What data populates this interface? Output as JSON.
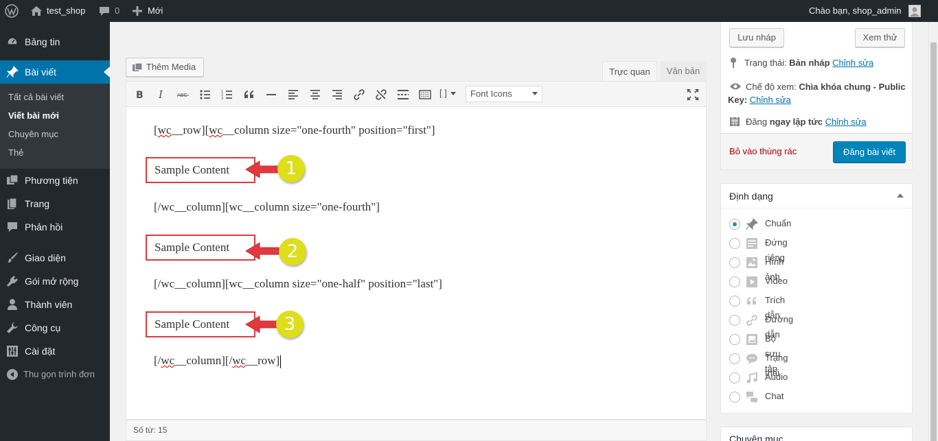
{
  "adminbar": {
    "site_name": "test_shop",
    "comments_count": "0",
    "new_label": "Mới",
    "greeting": "Chào bạn, shop_admin"
  },
  "sidebar": {
    "dashboard": "Bảng tin",
    "posts": "Bài viết",
    "posts_sub": [
      "Tất cả bài viết",
      "Viết bài mới",
      "Chuyên mục",
      "Thẻ"
    ],
    "media": "Phương tiện",
    "pages": "Trang",
    "comments": "Phản hồi",
    "appearance": "Giao diện",
    "plugins": "Gói mở rộng",
    "users": "Thành viên",
    "tools": "Công cụ",
    "settings": "Cài đặt",
    "collapse": "Thu gọn trình đơn"
  },
  "editor": {
    "add_media": "Thêm Media",
    "tab_visual": "Trực quan",
    "tab_text": "Văn bản",
    "font_icons": "Font Icons",
    "shortcode_label": "[ ]",
    "lines": {
      "l1_a": "[",
      "l1_b": "wc",
      "l1_c": "__row][",
      "l1_d": "wc",
      "l1_e": "__column size=\"one-fourth\" position=\"first\"]",
      "l2": "[/wc__column][wc__column size=\"one-fourth\"]",
      "l3": "[/wc__column][wc__column size=\"one-half\" position=\"last\"]",
      "l4_a": "[/",
      "l4_b": "wc",
      "l4_c": "__column][/",
      "l4_d": "wc",
      "l4_e": "__row]"
    },
    "samples": [
      "Sample Content",
      "Sample Content",
      "Sample Content"
    ],
    "badges": [
      "1",
      "2",
      "3"
    ],
    "word_count": "Số từ: 15"
  },
  "publish": {
    "save_draft": "Lưu nháp",
    "preview": "Xem thử",
    "status_label": "Trạng thái: ",
    "status_value": "Bản nháp",
    "edit": "Chỉnh sửa",
    "visibility_label": "Chế độ xem: ",
    "visibility_value": "Chìa khóa chung - Public",
    "visibility_value2": "Key: ",
    "schedule_label": "Đăng ",
    "schedule_value": "ngay lập tức",
    "trash": "Bỏ vào thùng rác",
    "publish_btn": "Đăng bài viết"
  },
  "format": {
    "title": "Định dạng",
    "options": [
      "Chuẩn",
      "Đứng riêng",
      "Hình ảnh",
      "Video",
      "Trích dẫn",
      "Đường dẫn",
      "Bộ sưu tập",
      "Trạng thái",
      "Audio",
      "Chat"
    ],
    "selected": "Chuẩn"
  },
  "categories": {
    "title": "Chuyên mục"
  },
  "colors": {
    "accent": "#0073aa",
    "admin_dark": "#23282d",
    "highlight_box": "#e0393e",
    "badge": "#dede1a"
  }
}
